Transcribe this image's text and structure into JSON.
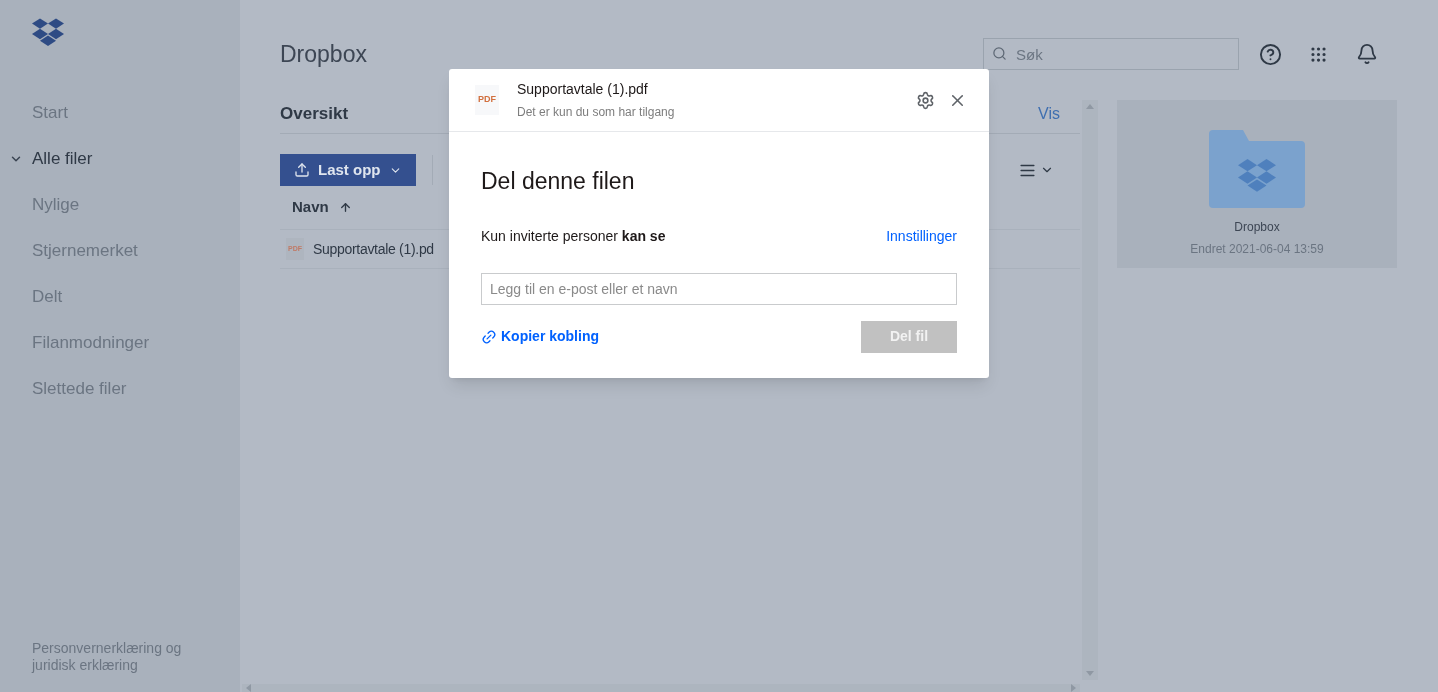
{
  "sidebar": {
    "items": [
      {
        "label": "Start",
        "selected": false
      },
      {
        "label": "Alle filer",
        "selected": true,
        "expanded": true
      },
      {
        "label": "Nylige",
        "selected": false
      },
      {
        "label": "Stjernemerket",
        "selected": false
      },
      {
        "label": "Delt",
        "selected": false
      },
      {
        "label": "Filanmodninger",
        "selected": false
      },
      {
        "label": "Slettede filer",
        "selected": false
      }
    ],
    "footer": "Personvernerklæring og juridisk erklæring"
  },
  "header": {
    "title": "Dropbox",
    "search": {
      "placeholder": "Søk"
    }
  },
  "overview": {
    "title": "Oversikt",
    "link": "Vis"
  },
  "toolbar": {
    "upload": "Last opp"
  },
  "table": {
    "columns": [
      {
        "label": "Navn",
        "sort_ascending": true
      }
    ],
    "rows": [
      {
        "icon": "PDF",
        "name": "Supportavtale (1).pd"
      }
    ]
  },
  "preview": {
    "name": "Dropbox",
    "modified": "Endret 2021-06-04 13:59"
  },
  "dialog": {
    "file": {
      "icon": "PDF",
      "name": "Supportavtale (1).pdf",
      "access": "Det er kun du som har tilgang"
    },
    "title": "Del denne filen",
    "permission": "Kun inviterte personer **kan se**",
    "settings": "Innstillinger",
    "input": {
      "placeholder": "Legg til en e-post eller et navn"
    },
    "copy_link": "Kopier kobling",
    "share": {
      "label": "Del fil",
      "disabled": true
    }
  }
}
